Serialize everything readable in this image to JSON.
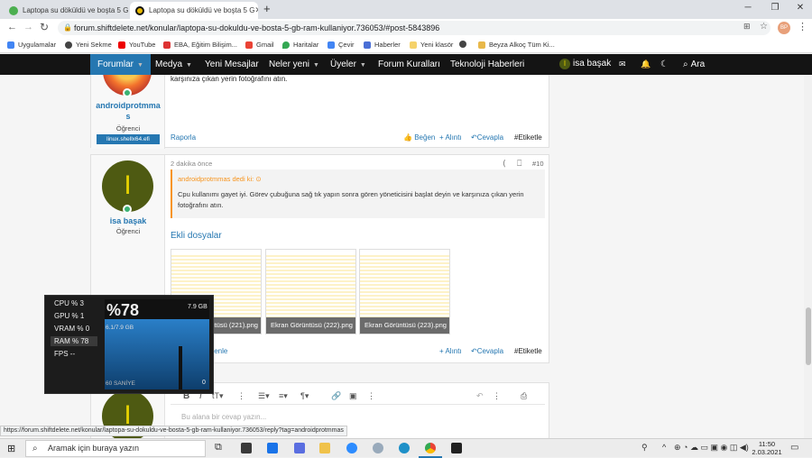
{
  "browser": {
    "tabs": [
      {
        "title": "Laptopa su döküldü ve boşta 5 G",
        "active": false
      },
      {
        "title": "Laptopa su döküldü ve boşta 5 G",
        "active": true
      }
    ],
    "new_tab": "+",
    "window_controls": [
      "─",
      "❐",
      "✕"
    ],
    "url": "forum.shiftdelete.net/konular/laptopa-su-dokuldu-ve-bosta-5-gb-ram-kullaniyor.736053/#post-5843896",
    "profile_initials": "BP",
    "bookmarks": [
      "Uygulamalar",
      "Yeni Sekme",
      "YouTube",
      "EBA, Eğitim Bilişim...",
      "Gmail",
      "Haritalar",
      "Çevir",
      "Haberler",
      "Yeni klasör",
      "",
      "Beyza Alkoç Tüm Ki..."
    ]
  },
  "sitenav": {
    "items": [
      "Forumlar",
      "Medya",
      "Yeni Mesajlar",
      "Neler yeni",
      "Üyeler",
      "Forum Kuralları",
      "Teknoloji Haberleri"
    ],
    "user": "isa başak",
    "user_initial": "I",
    "search": "Ara"
  },
  "post_prev": {
    "text": "karşınıza çıkan yerin fotoğrafını atın.",
    "username": "androidprotmma s",
    "role": "Öğrenci",
    "banner": "linux.shellx64.efi",
    "report": "Raporla",
    "like": "Beğen",
    "quote": "+ Alıntı",
    "reply": "Cevapla",
    "tag": "#Etiketle"
  },
  "post": {
    "time": "2 dakika önce",
    "number": "#10",
    "username": "isa başak",
    "initial": "I",
    "role": "Öğrenci",
    "quote_author": "androidprotmmas dedi ki:",
    "quote_text": "Cpu kullanımı gayet iyi. Görev çubuğuna sağ tık yapın sonra gören yöneticisini başlat deyin ve karşınıza çıkan yerin fotoğrafını atın.",
    "attachments_title": "Ekli dosyalar",
    "attachments": [
      "Ekran Görüntüsü (221).png",
      "Ekran Görüntüsü (222).png",
      "Ekran Görüntüsü (223).png"
    ],
    "edit": "Düzenle",
    "quote": "+ Alıntı",
    "reply": "Cevapla",
    "tag": "#Etiketle"
  },
  "editor": {
    "placeholder": "Bu alana bir cevap yazın..."
  },
  "overlay": {
    "rows": [
      {
        "label": "CPU %",
        "value": "3"
      },
      {
        "label": "GPU %",
        "value": "1"
      },
      {
        "label": "VRAM %",
        "value": "0"
      },
      {
        "label": "RAM %",
        "value": "78"
      },
      {
        "label": "FPS",
        "value": "--"
      }
    ],
    "big_value": "%78",
    "total": "7.9 GB",
    "used": "6.1/7.9 GB",
    "window": "60 SANİYE",
    "min": "0",
    "ram_fraction": 0.78
  },
  "status_url": "https://forum.shiftdelete.net/konular/laptopa-su-dokuldu-ve-bosta-5-gb-ram-kullaniyor.736053/reply?tag=androidprotmmas",
  "taskbar": {
    "search_placeholder": "Aramak için buraya yazın",
    "time": "11:50",
    "date": "2.03.2021"
  },
  "colors": {
    "accent": "#2577b1",
    "nav_bg": "#141414",
    "avatar": "#4e5a12",
    "quote_border": "#f7941d"
  }
}
